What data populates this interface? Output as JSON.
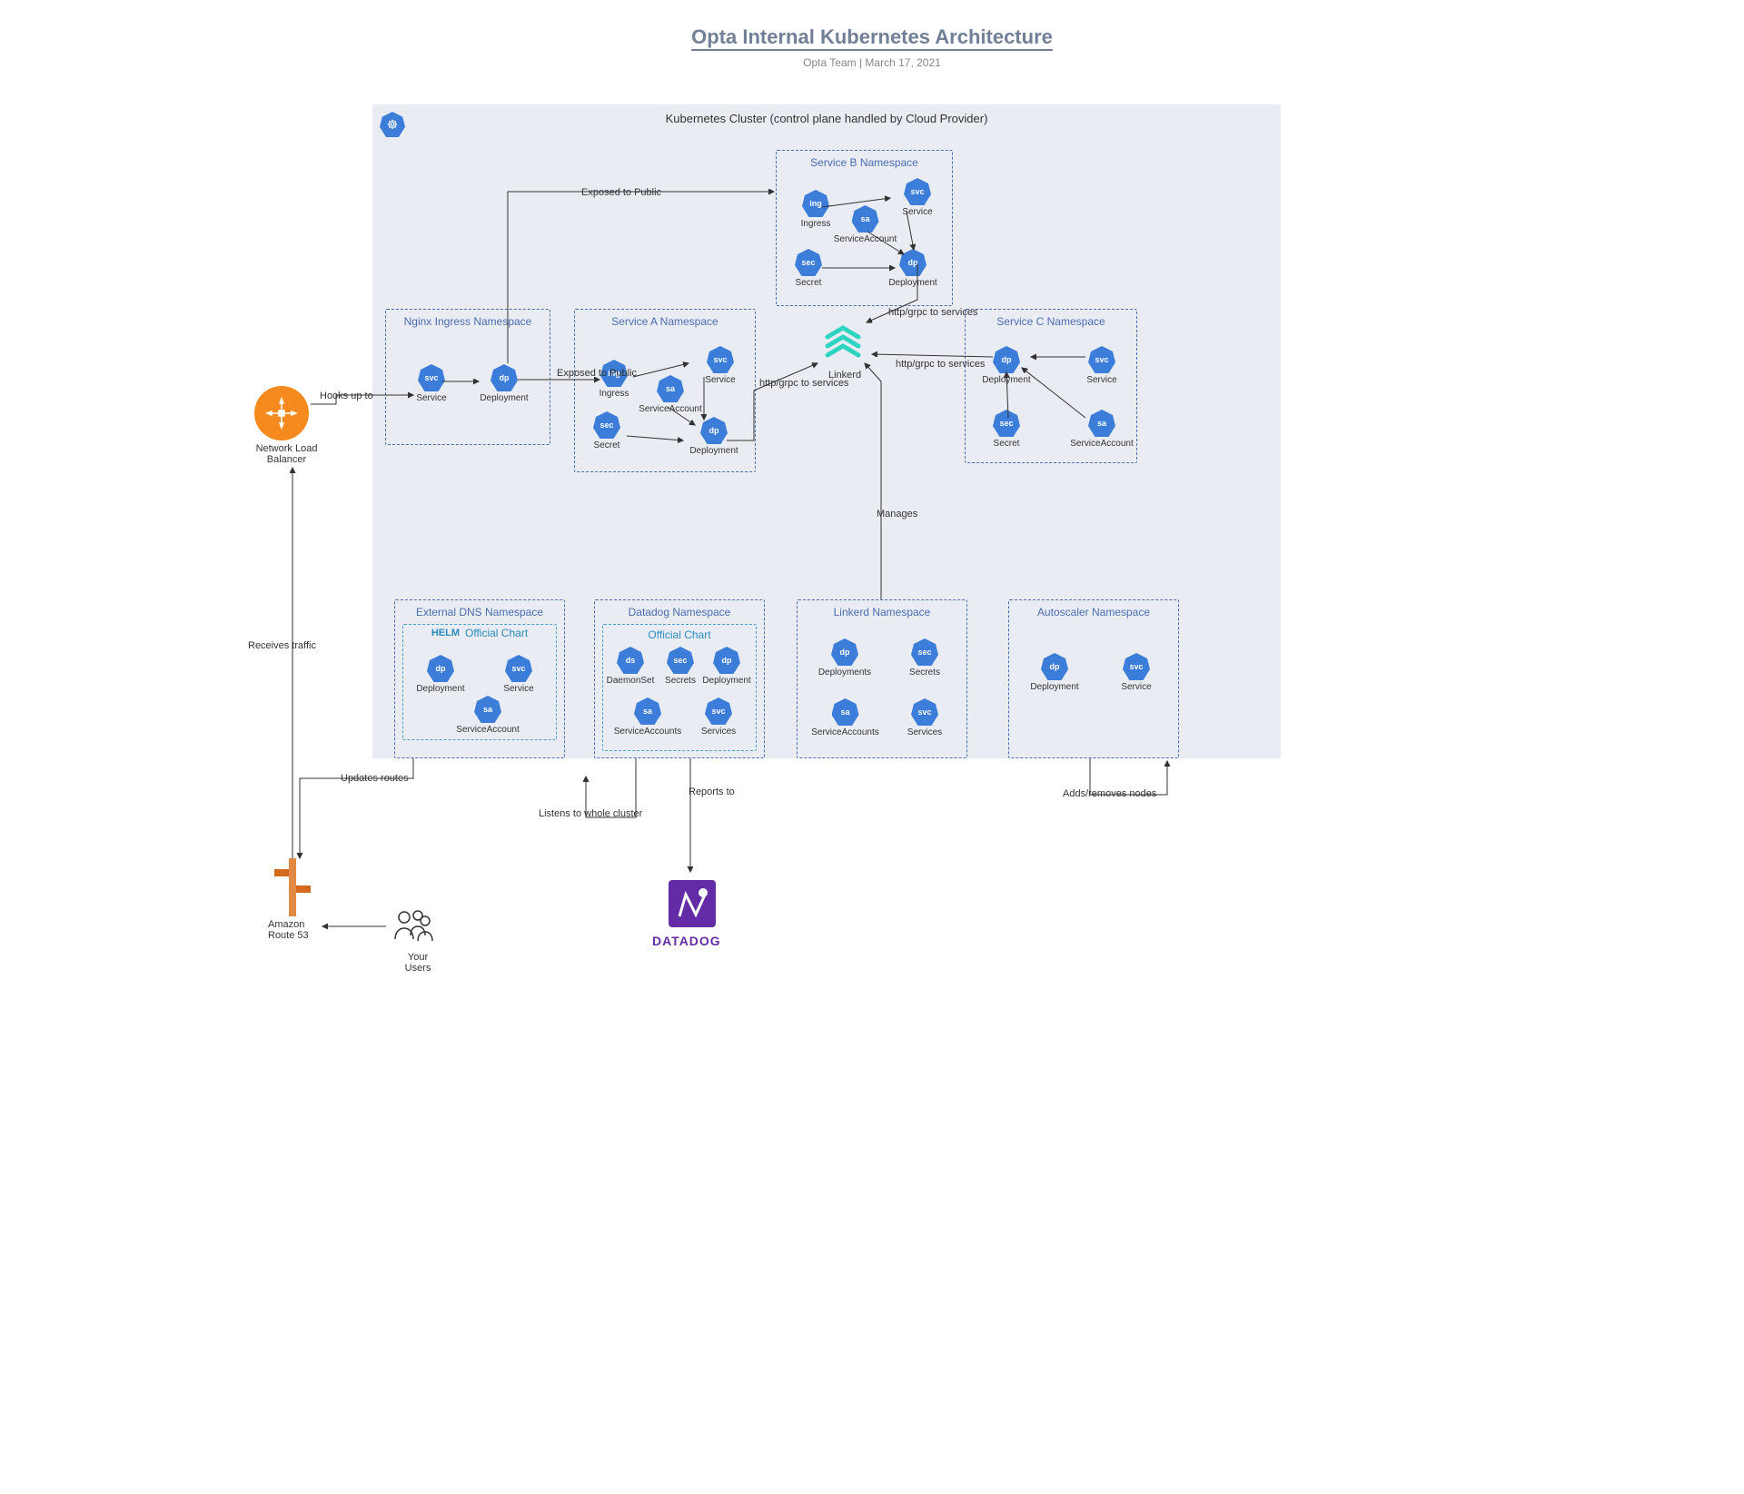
{
  "page": {
    "title": "Opta Internal Kubernetes Architecture",
    "subtitle": "Opta Team  |  March 17, 2021"
  },
  "cluster": {
    "label": "Kubernetes Cluster (control plane handled by Cloud Provider)"
  },
  "namespaces": {
    "nginx_ingress": {
      "title": "Nginx Ingress Namespace",
      "service": "Service",
      "deployment": "Deployment"
    },
    "service_a": {
      "title": "Service A Namespace",
      "ingress": "Ingress",
      "service": "Service",
      "sa": "ServiceAccount",
      "secret": "Secret",
      "deployment": "Deployment"
    },
    "service_b": {
      "title": "Service B Namespace",
      "ingress": "Ingress",
      "service": "Service",
      "sa": "ServiceAccount",
      "secret": "Secret",
      "deployment": "Deployment"
    },
    "service_c": {
      "title": "Service C Namespace",
      "deployment": "Deployment",
      "service": "Service",
      "secret": "Secret",
      "sa": "ServiceAccount"
    },
    "external_dns": {
      "title": "External DNS Namespace",
      "chart": "Official Chart",
      "helm": "HELM",
      "deployment": "Deployment",
      "service": "Service",
      "sa": "ServiceAccount"
    },
    "datadog": {
      "title": "Datadog Namespace",
      "chart": "Official Chart",
      "daemonset": "DaemonSet",
      "secrets": "Secrets",
      "deployment": "Deployment",
      "sa": "ServiceAccounts",
      "services": "Services"
    },
    "linkerd_ns": {
      "title": "Linkerd Namespace",
      "deployments": "Deployments",
      "secrets": "Secrets",
      "sa": "ServiceAccounts",
      "services": "Services"
    },
    "autoscaler": {
      "title": "Autoscaler Namespace",
      "deployment": "Deployment",
      "service": "Service"
    }
  },
  "linkerd": {
    "label": "Linkerd"
  },
  "external": {
    "nlb": "Network Load Balancer",
    "route53": "Amazon Route 53",
    "users": "Your Users",
    "datadog": "DATADOG"
  },
  "edges": {
    "hooks_up_to": "Hooks up to",
    "receives_traffic": "Receives traffic",
    "exposed_nginx": "Exposed to Public",
    "exposed_b": "Exposed to Public",
    "http_a": "http/grpc to services",
    "http_b": "http/grpc to services",
    "http_c": "http/grpc to services",
    "manages": "Manages",
    "updates_routes": "Updates routes",
    "listens": "Listens to whole cluster",
    "reports_to": "Reports to",
    "adds_removes": "Adds/removes nodes"
  }
}
